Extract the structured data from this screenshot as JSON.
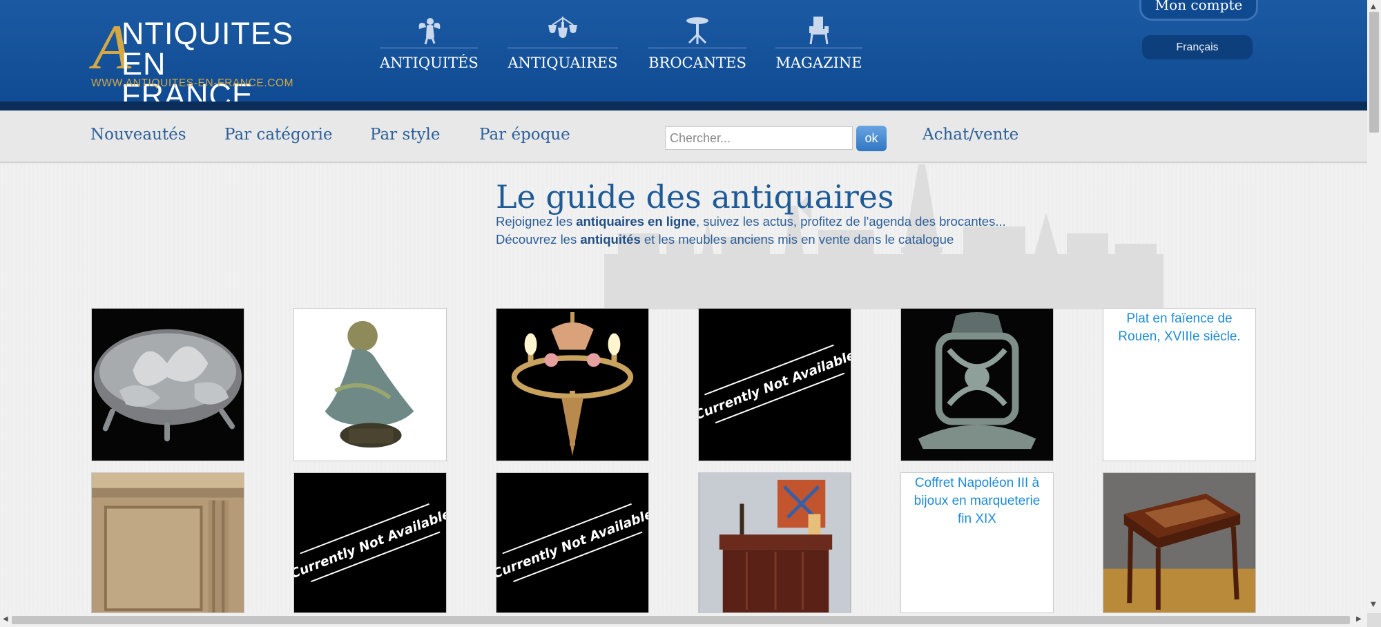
{
  "logo": {
    "line1": "NTIQUITES",
    "line2": "EN FRANCE",
    "initial": "A",
    "url": "WWW.ANTIQUITES-EN-FRANCE.COM"
  },
  "main_nav": [
    {
      "label": "ANTIQUITÉS",
      "icon": "cherub-icon"
    },
    {
      "label": "ANTIQUAIRES",
      "icon": "chandelier-icon"
    },
    {
      "label": "BROCANTES",
      "icon": "gueridon-table-icon"
    },
    {
      "label": "MAGAZINE",
      "icon": "armchair-icon"
    }
  ],
  "account": {
    "label": "Mon compte"
  },
  "language": {
    "label": "Français"
  },
  "sub_nav": {
    "items": [
      "Nouveautés",
      "Par catégorie",
      "Par style",
      "Par époque"
    ],
    "buy_sell": "Achat/vente"
  },
  "search": {
    "placeholder": "Chercher...",
    "button": "ok"
  },
  "headline": "Le guide des antiquaires",
  "intro": {
    "line1_pre": "Rejoignez les ",
    "line1_bold": "antiquaires en ligne",
    "line1_post": ", suivez les actus, profitez de l'agenda des brocantes...",
    "line2_pre": "Découvrez les ",
    "line2_bold": "antiquités",
    "line2_post": " et les meubles anciens mis en vente dans le catalogue"
  },
  "gallery": {
    "unavailable_text": "Currently Not Available",
    "alt_texts": {
      "plat": "Plat en faïence de Rouen, XVIIIe siècle.",
      "coffret": "Coffret Napoléon III à bijoux en marqueterie fin XIX"
    }
  },
  "colors": {
    "header_blue": "#0f4a91",
    "gold": "#d4a843",
    "link_blue": "#2b5f99",
    "alt_link": "#1e8ad6"
  }
}
